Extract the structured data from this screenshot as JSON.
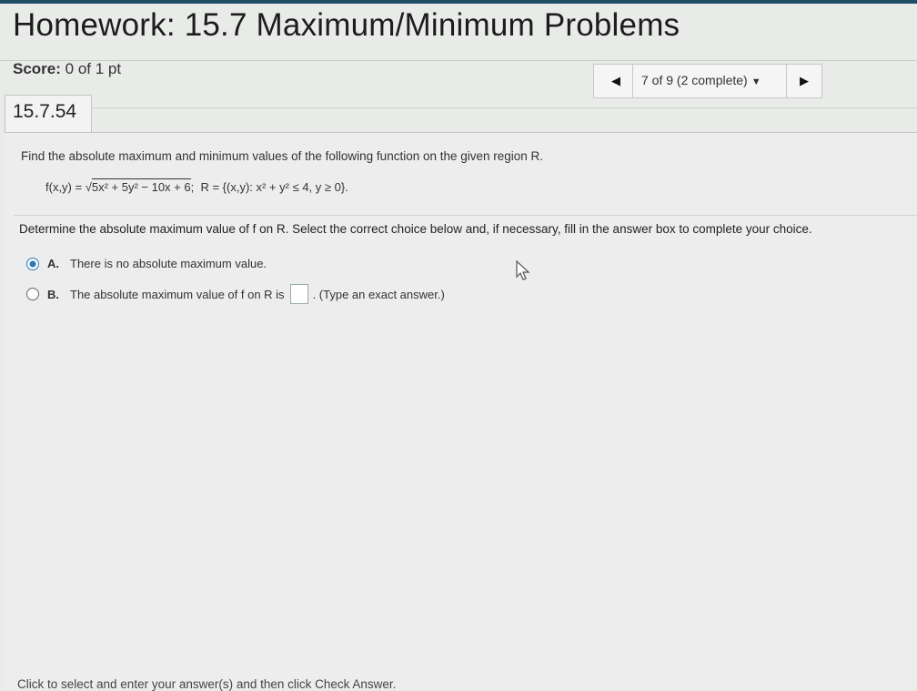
{
  "header": {
    "title": "Homework: 15.7 Maximum/Minimum Problems",
    "score_label": "Score:",
    "score_value": "0 of 1 pt"
  },
  "nav": {
    "status": "7 of 9 (2 complete)"
  },
  "question": {
    "number": "15.7.54",
    "prompt": "Find the absolute maximum and minimum values of the following function on the given region R.",
    "formula": {
      "lhs": "f(x,y) = ",
      "radicand": "5x² + 5y² − 10x + 6",
      "region": "R = {(x,y): x² + y² ≤ 4, y ≥ 0}."
    },
    "instruction": "Determine the absolute maximum value of f on R. Select the correct choice below and, if necessary, fill in the answer box to complete your choice.",
    "choices": [
      {
        "letter": "A.",
        "text": "There is no absolute maximum value.",
        "selected": true
      },
      {
        "letter": "B.",
        "text_before": "The absolute maximum value of f on R is",
        "text_after": ". (Type an exact answer.)",
        "answer_value": "",
        "selected": false
      }
    ]
  },
  "footer": {
    "hint": "Click to select and enter your answer(s) and then click Check Answer."
  },
  "colors": {
    "accent": "#2b79b8",
    "top_rule": "#1f4e66"
  }
}
